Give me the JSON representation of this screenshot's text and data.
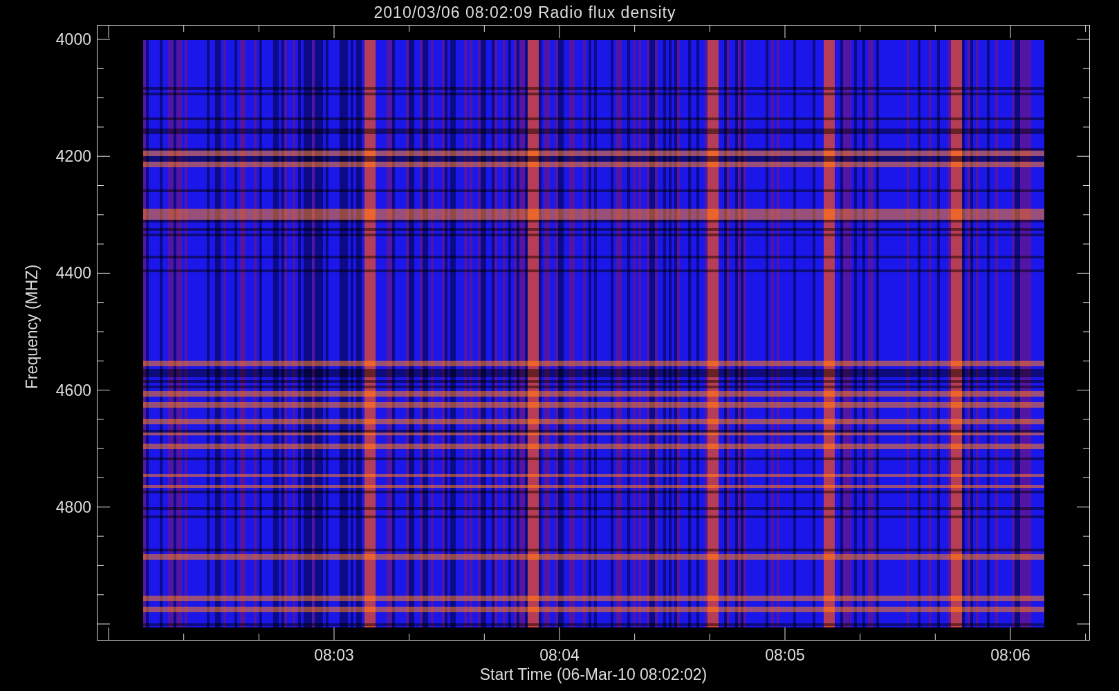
{
  "title": "2010/03/06 08:02:09 Radio flux density",
  "y_axis": {
    "label": "Frequency (MHZ)",
    "ticks": [
      "4000",
      "4200",
      "4400",
      "4600",
      "4800"
    ]
  },
  "x_axis": {
    "label": "Start Time (06-Mar-10 08:02:02)",
    "ticks": [
      "08:03",
      "08:04",
      "08:05",
      "08:06"
    ]
  }
}
